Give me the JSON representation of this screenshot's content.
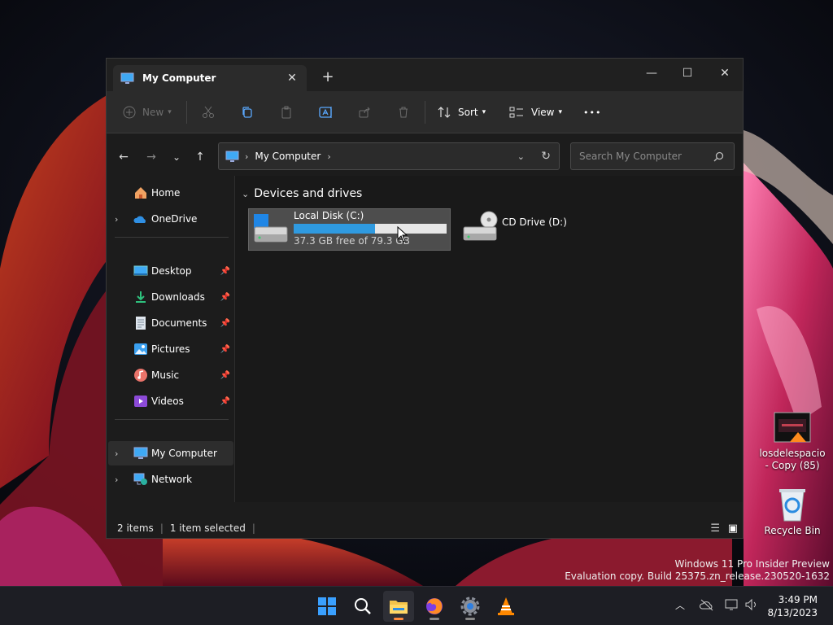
{
  "window": {
    "tab_title": "My Computer",
    "tab_close": "✕",
    "new_tab": "+",
    "minimize": "—",
    "maximize": "☐",
    "close": "✕"
  },
  "commandbar": {
    "new_label": "New",
    "sort_label": "Sort",
    "view_label": "View",
    "more_label": "•••"
  },
  "address": {
    "path": "My Computer",
    "search_placeholder": "Search My Computer"
  },
  "navpane": {
    "home": "Home",
    "onedrive": "OneDrive",
    "quick_access": [
      {
        "label": "Desktop"
      },
      {
        "label": "Downloads"
      },
      {
        "label": "Documents"
      },
      {
        "label": "Pictures"
      },
      {
        "label": "Music"
      },
      {
        "label": "Videos"
      }
    ],
    "my_computer": "My Computer",
    "network": "Network"
  },
  "content": {
    "group_title": "Devices and drives",
    "drives": [
      {
        "name": "Local Disk (C:)",
        "free_text": "37.3 GB free of 79.3 GB",
        "used_fraction": 0.53,
        "bar_color": "#2f9ae0"
      },
      {
        "name": "CD Drive (D:)"
      }
    ]
  },
  "status": {
    "item_count": "2 items",
    "selected": "1 item selected"
  },
  "desktop": {
    "video_icon_label": "losdelespacio - Copy (85)",
    "recycle_label": "Recycle Bin",
    "watermark_line1": "Windows 11 Pro Insider Preview",
    "watermark_line2": "Evaluation copy. Build 25375.zn_release.230520-1632"
  },
  "taskbar": {
    "time": "3:49 PM",
    "date": "8/13/2023"
  },
  "colors": {
    "accent": "#2f9ae0",
    "active_indicator": "#ff8a3d"
  }
}
